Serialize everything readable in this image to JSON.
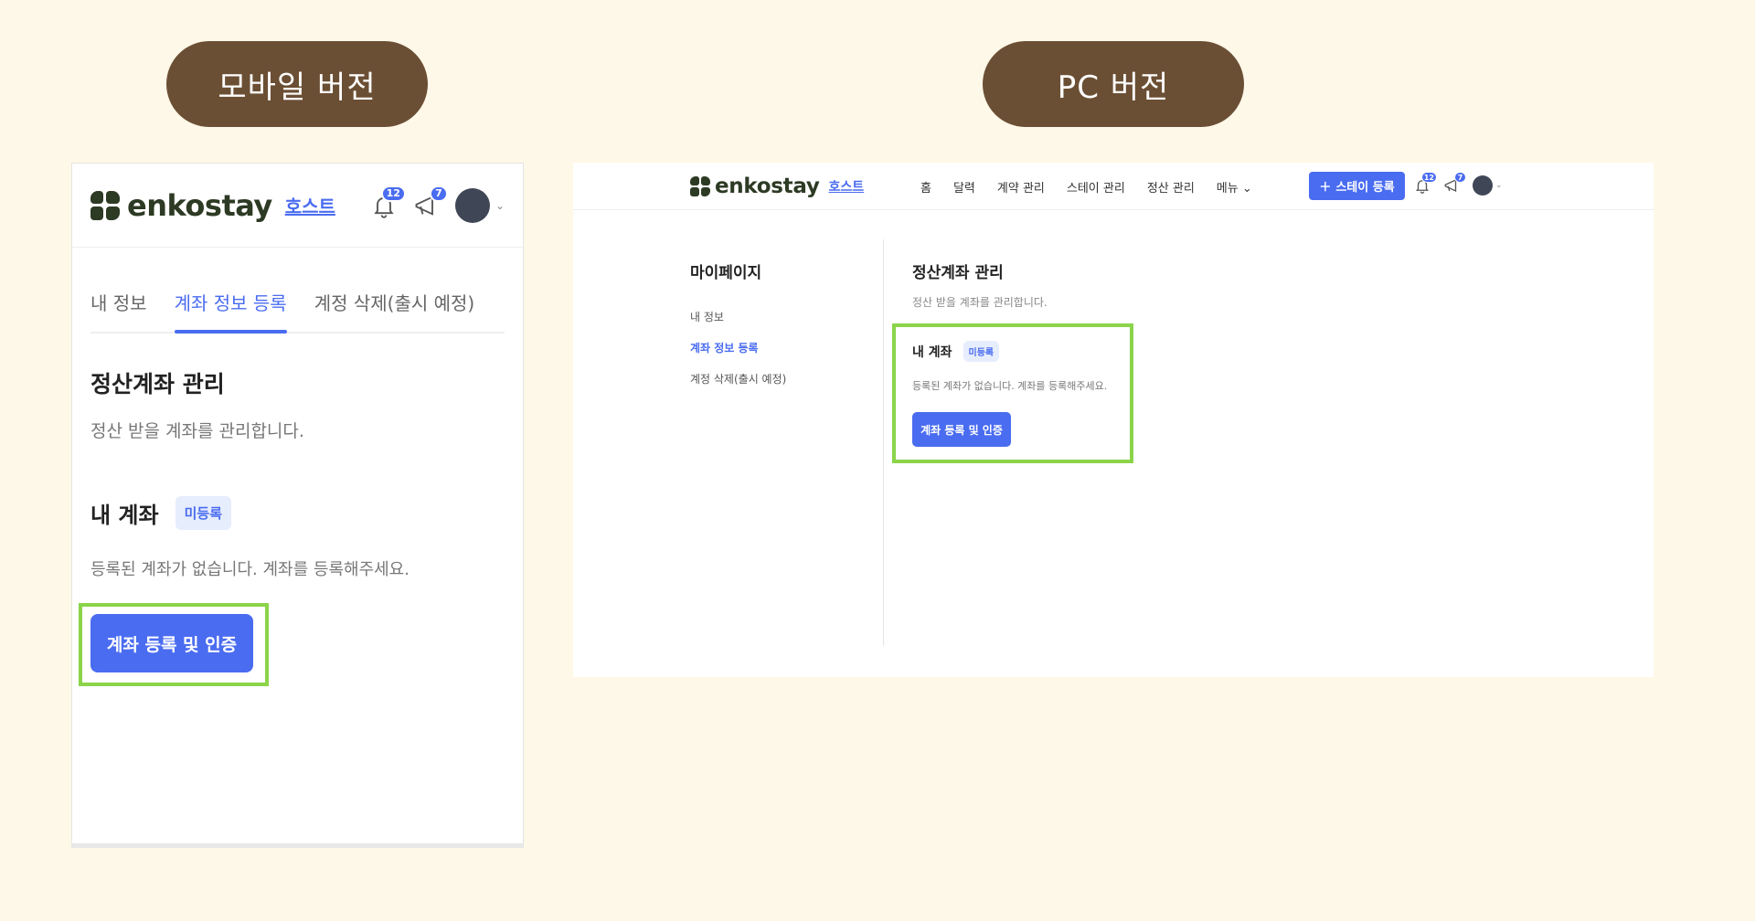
{
  "labels": {
    "mobile": "모바일 버전",
    "pc": "PC 버전"
  },
  "brand": {
    "name": "enkostay",
    "host": "호스트",
    "color": "#2d3a24"
  },
  "notifications": {
    "bell_count": "12",
    "message_count": "7"
  },
  "mobile": {
    "tabs": [
      {
        "label": "내 정보",
        "active": false
      },
      {
        "label": "계좌 정보 등록",
        "active": true
      },
      {
        "label": "계정 삭제(출시 예정)",
        "active": false
      }
    ]
  },
  "pc": {
    "nav": [
      "홈",
      "달력",
      "계약 관리",
      "스테이 관리",
      "정산 관리",
      "메뉴"
    ],
    "add_button": "스테이 등록",
    "sidebar_title": "마이페이지",
    "sidebar": [
      {
        "label": "내 정보",
        "active": false
      },
      {
        "label": "계좌 정보 등록",
        "active": true
      },
      {
        "label": "계정 삭제(출시 예정)",
        "active": false
      }
    ]
  },
  "content": {
    "title": "정산계좌 관리",
    "description": "정산 받을 계좌를 관리합니다.",
    "account_title": "내 계좌",
    "status_tag": "미등록",
    "empty_message": "등록된 계좌가 없습니다. 계좌를 등록해주세요.",
    "register_button": "계좌 등록 및 인증"
  },
  "colors": {
    "background": "#fef8e8",
    "pill": "#6b4f34",
    "accent": "#4a6cf0",
    "highlight": "#8bd44a"
  }
}
